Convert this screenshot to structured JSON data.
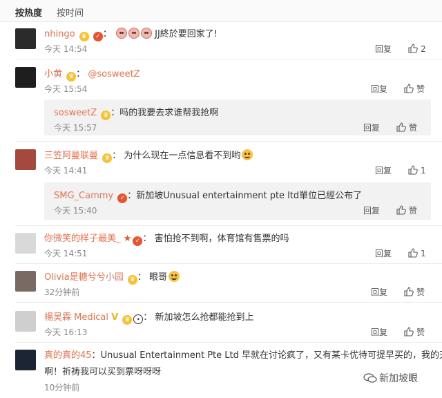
{
  "sort_tabs": {
    "by_heat": "按热度",
    "by_time": "按时间"
  },
  "colors": {
    "username": "#eb7350",
    "time": "#888888",
    "action": "#555555",
    "divider": "#ececec",
    "subbox": "#f2f2f2"
  },
  "actions": {
    "reply": "回复",
    "like_label": "赞"
  },
  "comments": [
    {
      "user": "nhingo",
      "sep": "：",
      "text": "JJ終於要回家了!",
      "time": "今天 14:54",
      "likes": "2"
    },
    {
      "user": "小黄",
      "sep": "：",
      "text": "@sosweetZ",
      "time": "今天 15:54",
      "reply": {
        "user": "sosweetZ",
        "sep": "：",
        "text": "吗的我要去求谁帮我抢啊",
        "time": "今天 15:57"
      }
    },
    {
      "user": "三笠阿曼联曼",
      "sep": "：",
      "text": "为什么现在一点信息看不到哟",
      "time": "今天 14:41",
      "likes": "1",
      "reply": {
        "user": "SMG_Cammy",
        "sep": "：",
        "text": "新加坡Unusual entertainment pte ltd單位已經公布了",
        "time": "今天 15:40"
      }
    },
    {
      "user": "你微笑的样子最美_",
      "sep": "：",
      "text": "害怕抢不到啊，体育馆有售票的吗",
      "time": "今天 14:51",
      "likes": "1"
    },
    {
      "user": "Olivia是糖兮兮小园",
      "sep": "：",
      "text": "眼哥",
      "time": "32分钟前"
    },
    {
      "user": "楊昊霖 Medical",
      "sep": "：",
      "text": "新加坡怎么抢都能抢到上",
      "time": "今天 16:13"
    },
    {
      "user": "真的真的45",
      "sep": "：",
      "text": "Unusual Entertainment Pte Ltd 早就在讨论疯了，又有某卡优待可提早买的，我的天",
      "text2": "啊！祈祷我可以买到票呀呀呀",
      "time": "10分钟前"
    }
  ],
  "watermark": "新加坡眼",
  "icons": {
    "like": "thumbs-up-icon",
    "watermark": "wechat-icon"
  }
}
